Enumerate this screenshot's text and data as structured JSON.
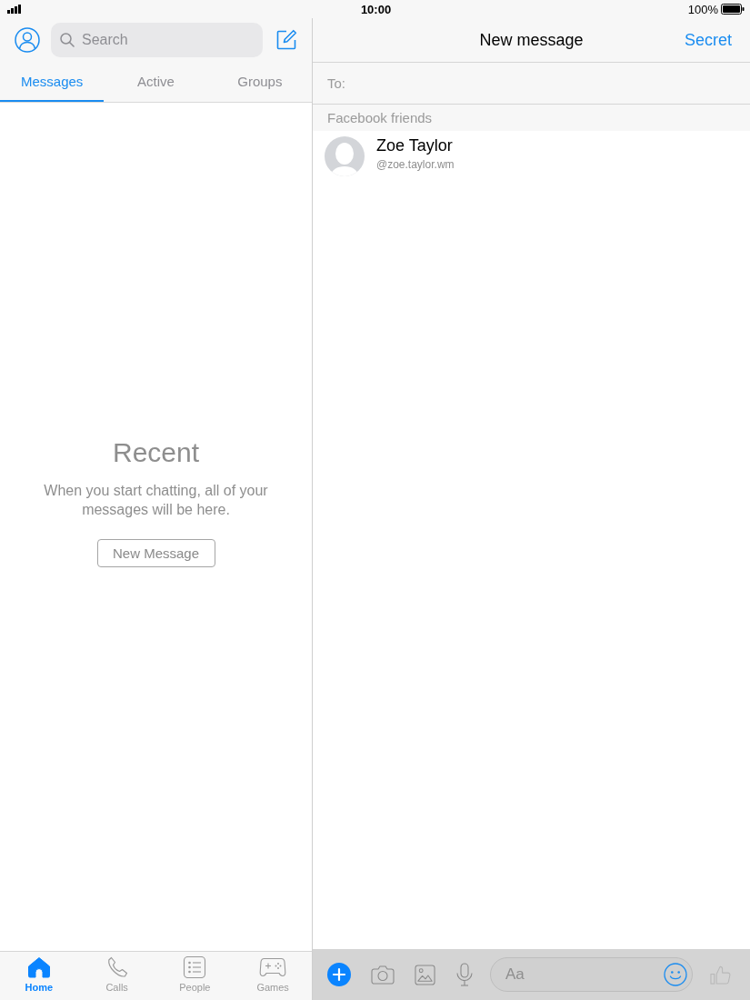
{
  "status_bar": {
    "time": "10:00",
    "battery": "100%"
  },
  "sidebar": {
    "search": {
      "placeholder": "Search"
    },
    "tabs": [
      {
        "label": "Messages",
        "selected": true
      },
      {
        "label": "Active",
        "selected": false
      },
      {
        "label": "Groups",
        "selected": false
      }
    ],
    "empty_state": {
      "title": "Recent",
      "text": "When you start chatting, all of your messages will be here.",
      "button": "New Message"
    },
    "bottom_nav": [
      {
        "kind": "home",
        "label": "Home",
        "selected": true
      },
      {
        "kind": "calls",
        "label": "Calls",
        "selected": false
      },
      {
        "kind": "people",
        "label": "People",
        "selected": false
      },
      {
        "kind": "games",
        "label": "Games",
        "selected": false
      }
    ]
  },
  "conversation": {
    "title": "New message",
    "action": "Secret",
    "recipient": {
      "label": "To:"
    },
    "section": "Facebook friends",
    "contacts": [
      {
        "name": "Zoe Taylor",
        "handle": "@zoe.taylor.wm"
      }
    ],
    "composer": {
      "placeholder": "Aa"
    }
  }
}
